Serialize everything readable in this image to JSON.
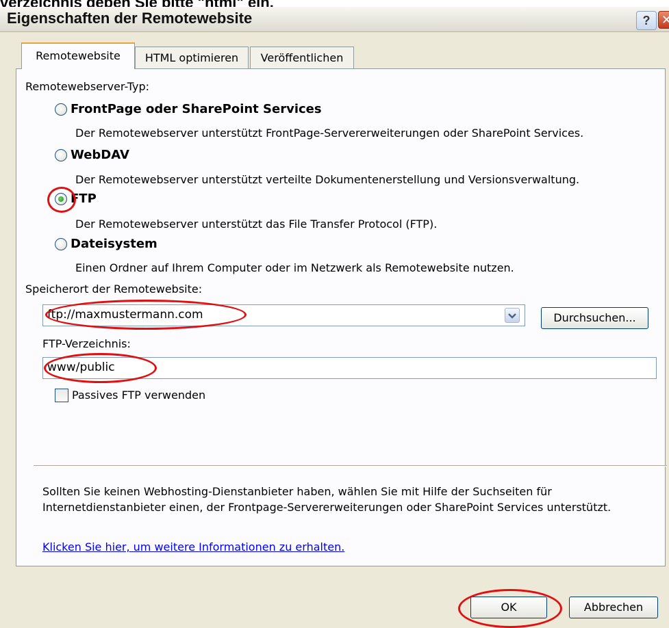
{
  "page_header_fragment": "verzeichnis geben Sie bitte \"html\" ein.",
  "dialog": {
    "title": "Eigenschaften der Remotewebsite",
    "help_glyph": "?",
    "close_glyph": "✕"
  },
  "tabs": [
    {
      "label": "Remotewebsite",
      "active": true
    },
    {
      "label": "HTML optimieren",
      "active": false
    },
    {
      "label": "Veröffentlichen",
      "active": false
    }
  ],
  "server_type": {
    "label": "Remotewebserver-Typ:",
    "options": [
      {
        "label": "FrontPage oder SharePoint Services",
        "description": "Der Remotewebserver unterstützt FrontPage-Servererweiterungen oder SharePoint Services.",
        "selected": false
      },
      {
        "label": "WebDAV",
        "description": "Der Remotewebserver unterstützt verteilte Dokumentenerstellung und Versionsverwaltung.",
        "selected": false
      },
      {
        "label": "FTP",
        "description": "Der Remotewebserver unterstützt das File Transfer Protocol (FTP).",
        "selected": true
      },
      {
        "label": "Dateisystem",
        "description": "Einen Ordner auf Ihrem Computer oder im Netzwerk als Remotewebsite nutzen.",
        "selected": false
      }
    ]
  },
  "location": {
    "label": "Speicherort der Remotewebsite:",
    "value": "ftp://maxmustermann.com",
    "browse_button": "Durchsuchen..."
  },
  "ftp_directory": {
    "label": "FTP-Verzeichnis:",
    "value": "www/public"
  },
  "passive_ftp": {
    "label": "Passives FTP verwenden",
    "checked": false
  },
  "info": {
    "text": "Sollten Sie keinen Webhosting-Dienstanbieter haben, wählen Sie mit Hilfe der Suchseiten für Internetdienstanbieter einen, der Frontpage-Servererweiterungen oder SharePoint Services unterstützt.",
    "link": "Klicken Sie hier, um weitere Informationen zu erhalten."
  },
  "buttons": {
    "ok": "OK",
    "cancel": "Abbrechen"
  },
  "colors": {
    "annotation_red": "#e01010",
    "dialog_bg": "#ece9d8",
    "link_blue": "#0000ff"
  }
}
